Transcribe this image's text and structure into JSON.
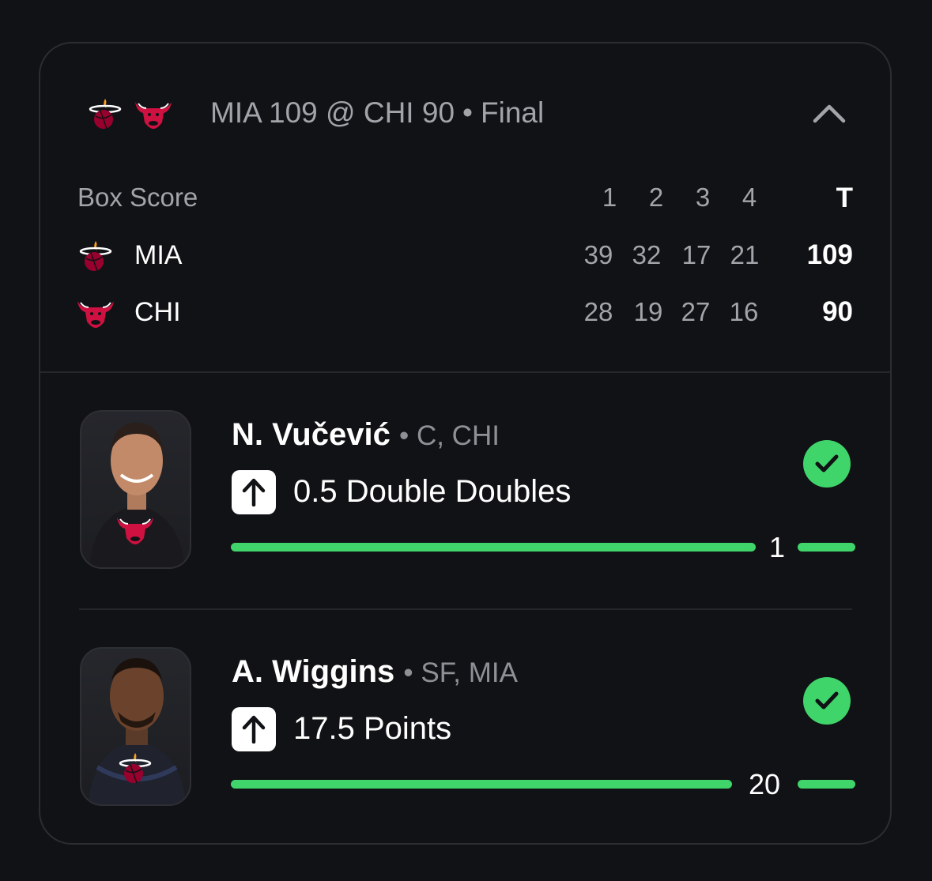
{
  "header": {
    "title": "MIA 109 @ CHI 90",
    "status": "Final"
  },
  "box_score": {
    "label": "Box Score",
    "periods": [
      "1",
      "2",
      "3",
      "4"
    ],
    "total_label": "T",
    "teams": [
      {
        "abbr": "MIA",
        "logo": "heat-logo-icon",
        "quarters": [
          "39",
          "32",
          "17",
          "21"
        ],
        "total": "109"
      },
      {
        "abbr": "CHI",
        "logo": "bulls-logo-icon",
        "quarters": [
          "28",
          "19",
          "27",
          "16"
        ],
        "total": "90"
      }
    ]
  },
  "players": [
    {
      "name": "N. Vučević",
      "position": "C, CHI",
      "direction": "over",
      "prop": "0.5 Double Doubles",
      "result": "1",
      "progress": 0.9,
      "hit": true,
      "team_logo": "bulls-logo-icon"
    },
    {
      "name": "A. Wiggins",
      "position": "SF, MIA",
      "direction": "over",
      "prop": "17.5 Points",
      "result": "20",
      "progress": 0.875,
      "hit": true,
      "team_logo": "heat-logo-icon"
    }
  ],
  "colors": {
    "background": "#111215",
    "accent_green": "#3fd56a",
    "muted_text": "#a2a4aa",
    "bulls_red": "#ce1141"
  }
}
